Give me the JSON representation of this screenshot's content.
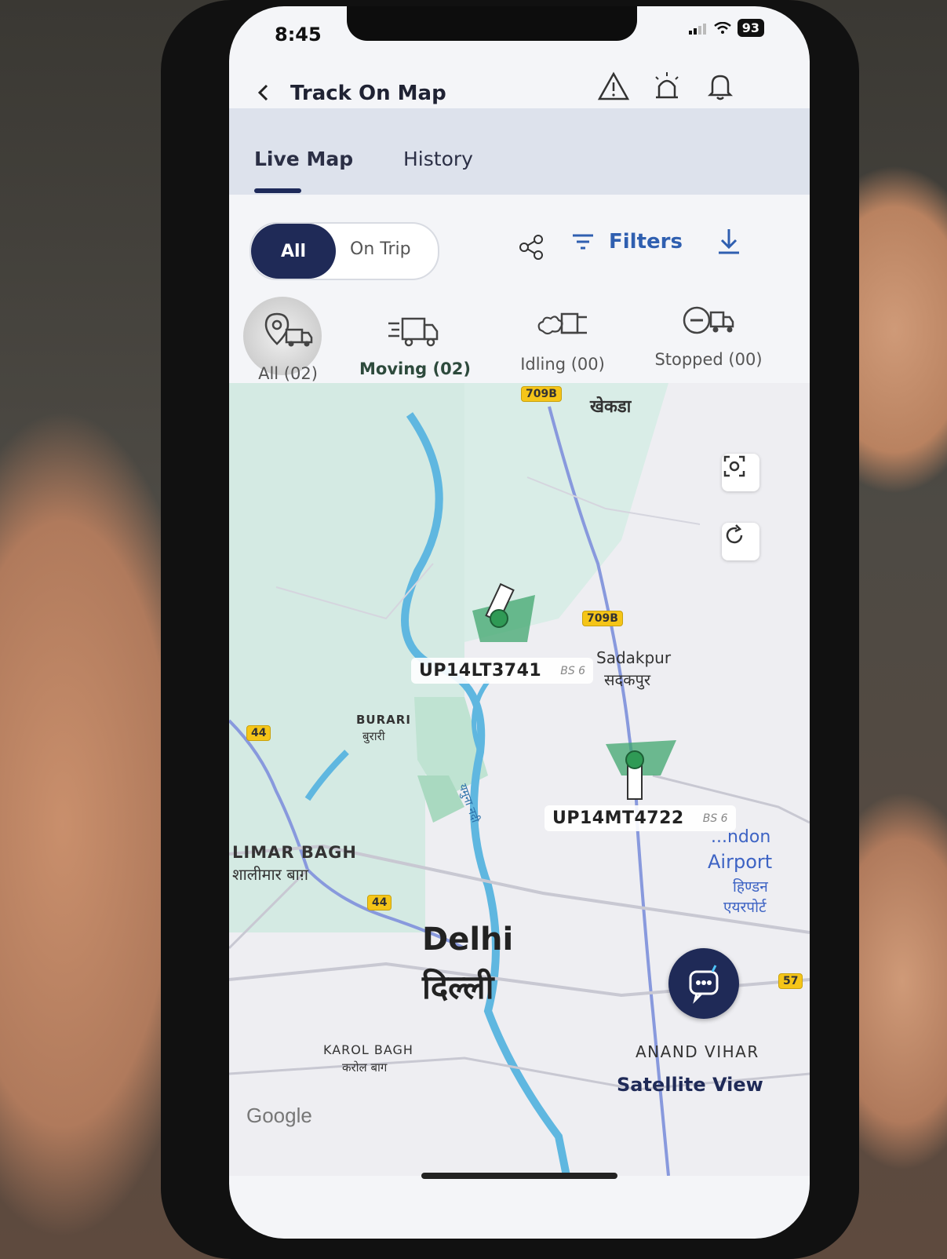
{
  "status_bar": {
    "time": "8:45",
    "battery": "93",
    "signal_icon": "signal-icon",
    "wifi_icon": "wifi-icon"
  },
  "header": {
    "title": "Track On Map",
    "back_icon": "chevron-left-icon",
    "icons": [
      "warning-triangle-icon",
      "siren-icon",
      "bell-icon"
    ]
  },
  "tabs": [
    {
      "label": "Live Map",
      "active": true
    },
    {
      "label": "History",
      "active": false
    }
  ],
  "trip_toggle": {
    "options": [
      "All",
      "On Trip"
    ],
    "selected": "All"
  },
  "toolbar": {
    "filters_label": "Filters"
  },
  "vehicle_status": [
    {
      "label": "All (02)",
      "icon": "location-truck-icon",
      "active": false
    },
    {
      "label": "Moving (02)",
      "icon": "moving-truck-icon",
      "active": true
    },
    {
      "label": "Idling (00)",
      "icon": "idling-truck-icon",
      "active": false
    },
    {
      "label": "Stopped (00)",
      "icon": "stopped-truck-icon",
      "active": false
    }
  ],
  "map": {
    "places": {
      "khekda": "खेकडा",
      "sadakpur": "Sadakpur",
      "sadakpur_hi": "सदकपुर",
      "burari": "BURARI",
      "burari_hi": "बुरारी",
      "shalimar": "LIMAR BAGH",
      "shalimar_hi": "शालीमार बाग़",
      "hindon": "...ndon",
      "airport": "Airport",
      "hindon_hi": "हिण्डन",
      "airport_hi": "एयरपोर्ट",
      "delhi": "Delhi",
      "delhi_hi": "दिल्ली",
      "karol": "KAROL BAGH",
      "karol_hi": "करोल बाग",
      "anand": "ANAND VIHAR",
      "river": "यमुना नदी"
    },
    "road_badges": {
      "r709b_top": "709B",
      "r709b_mid": "709B",
      "r44_left": "44",
      "r44_mid": "44",
      "r57": "57"
    },
    "vehicles": [
      {
        "plate": "UP14LT3741",
        "emission": "BS 6"
      },
      {
        "plate": "UP14MT4722",
        "emission": "BS 6"
      }
    ],
    "satellite_label": "Satellite View",
    "google_label": "Google"
  }
}
